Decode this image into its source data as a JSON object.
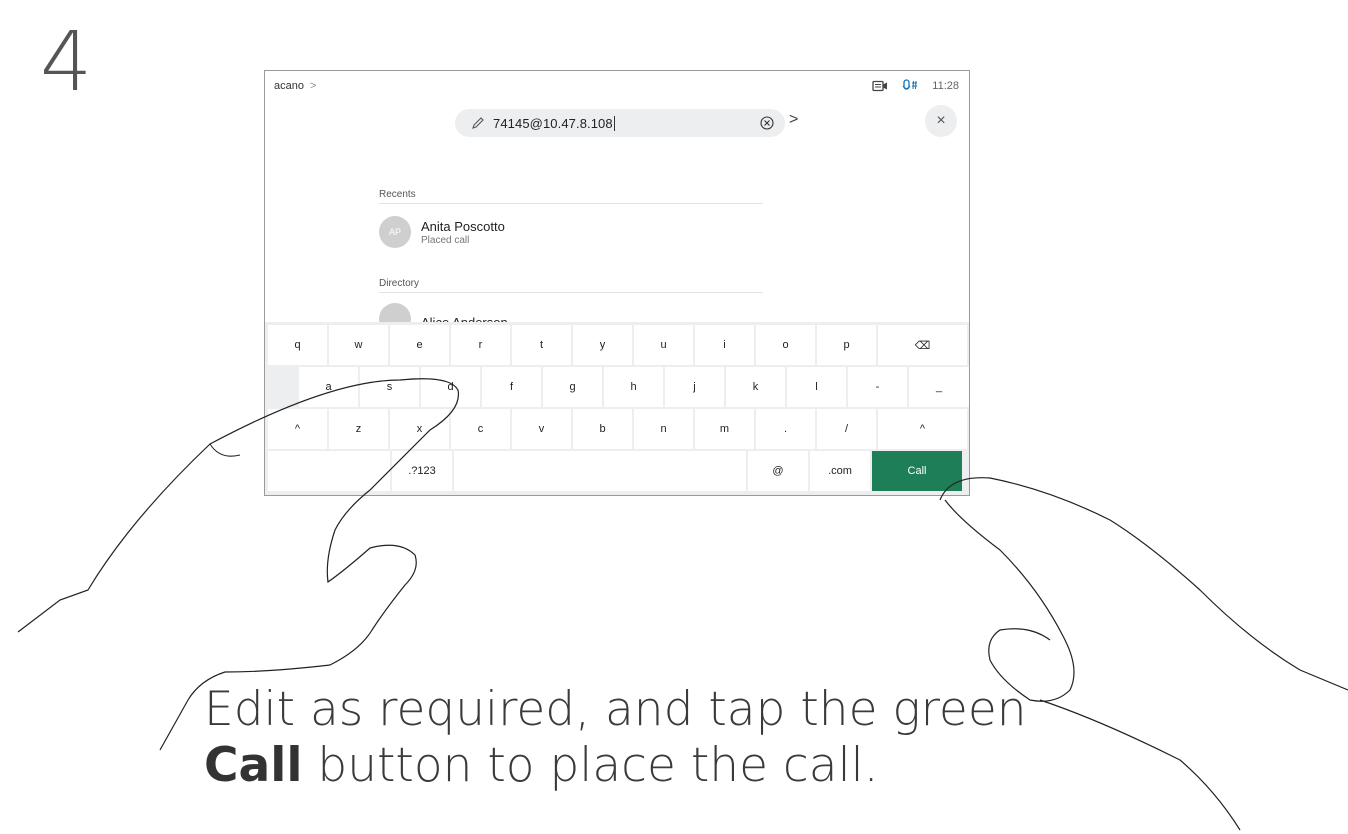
{
  "step": "4",
  "device": {
    "breadcrumb": {
      "label": "acano",
      "chevron": ">"
    },
    "status": {
      "time": "11:28",
      "camera_icon": "camera-icon",
      "mic_icon": "microphone-icon"
    },
    "search": {
      "value": "74145@10.47.8.108",
      "go": ">",
      "close": "×"
    },
    "recents": {
      "label": "Recents",
      "items": [
        {
          "initials": "AP",
          "name": "Anita Poscotto",
          "detail": "Placed call"
        }
      ]
    },
    "directory": {
      "label": "Directory",
      "items": [
        {
          "name": "Alice Anderson"
        }
      ]
    },
    "keyboard": {
      "row1": [
        "q",
        "w",
        "e",
        "r",
        "t",
        "y",
        "u",
        "i",
        "o",
        "p",
        "⌫"
      ],
      "row2": [
        "a",
        "s",
        "d",
        "f",
        "g",
        "h",
        "j",
        "k",
        "l",
        "-",
        "_"
      ],
      "row3": [
        "^",
        "z",
        "x",
        "c",
        "v",
        "b",
        "n",
        "m",
        ".",
        "/",
        "^"
      ],
      "row4": {
        "symbols": ".?123",
        "at": "@",
        "dotcom": ".com",
        "call": "Call"
      }
    },
    "accent_color": "#1e7e57"
  },
  "instruction": {
    "line1": "Edit as required, and tap the green",
    "bold": "Call",
    "rest": " button to place the call."
  }
}
